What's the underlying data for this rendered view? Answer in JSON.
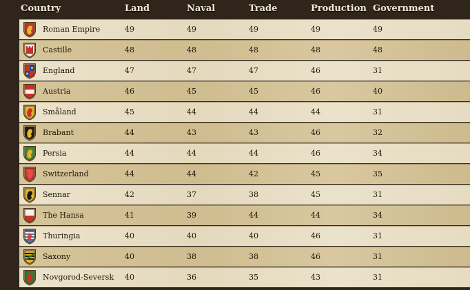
{
  "table": {
    "headers": [
      "Country",
      "Land",
      "Naval",
      "Trade",
      "Production",
      "Government"
    ],
    "rows": [
      {
        "country": "Roman Empire",
        "land": "49",
        "naval": "49",
        "trade": "49",
        "production": "49",
        "government": "49",
        "icon": "eagle-shield-icon",
        "shield_color": "#c8322a",
        "emblem_color": "#e8b830"
      },
      {
        "country": "Castille",
        "land": "48",
        "naval": "48",
        "trade": "48",
        "production": "48",
        "government": "48",
        "icon": "castle-shield-icon",
        "shield_color": "#f2f0ea",
        "emblem_color": "#c8322a"
      },
      {
        "country": "England",
        "land": "47",
        "naval": "47",
        "trade": "47",
        "production": "46",
        "government": "31",
        "icon": "quartered-shield-icon",
        "shield_color": "#2a3f9a",
        "emblem_color": "#c8322a"
      },
      {
        "country": "Austria",
        "land": "46",
        "naval": "45",
        "trade": "45",
        "production": "46",
        "government": "40",
        "icon": "fess-shield-icon",
        "shield_color": "#d42a2a",
        "emblem_color": "#f4f1ea"
      },
      {
        "country": "Småland",
        "land": "45",
        "naval": "44",
        "trade": "44",
        "production": "44",
        "government": "31",
        "icon": "lion-shield-icon",
        "shield_color": "#e3b32a",
        "emblem_color": "#c8322a"
      },
      {
        "country": "Brabant",
        "land": "44",
        "naval": "43",
        "trade": "43",
        "production": "46",
        "government": "32",
        "icon": "lion-shield-icon",
        "shield_color": "#1c1a16",
        "emblem_color": "#e3b32a"
      },
      {
        "country": "Persia",
        "land": "44",
        "naval": "44",
        "trade": "44",
        "production": "46",
        "government": "34",
        "icon": "lion-shield-icon",
        "shield_color": "#3d8a36",
        "emblem_color": "#e3b32a"
      },
      {
        "country": "Switzerland",
        "land": "44",
        "naval": "44",
        "trade": "42",
        "production": "45",
        "government": "35",
        "icon": "plain-shield-icon",
        "shield_color": "#d63030",
        "emblem_color": "#e85a4a"
      },
      {
        "country": "Sennar",
        "land": "42",
        "naval": "37",
        "trade": "38",
        "production": "45",
        "government": "31",
        "icon": "lion-shield-icon",
        "shield_color": "#e3b32a",
        "emblem_color": "#1c1a16"
      },
      {
        "country": "The Hansa",
        "land": "41",
        "naval": "39",
        "trade": "44",
        "production": "44",
        "government": "34",
        "icon": "per-fess-shield-icon",
        "shield_color": "#f4f1ea",
        "emblem_color": "#c8322a"
      },
      {
        "country": "Thuringia",
        "land": "40",
        "naval": "40",
        "trade": "40",
        "production": "46",
        "government": "31",
        "icon": "striped-lion-shield-icon",
        "shield_color": "#4a78c8",
        "emblem_color": "#d63030"
      },
      {
        "country": "Saxony",
        "land": "40",
        "naval": "38",
        "trade": "38",
        "production": "46",
        "government": "31",
        "icon": "barry-shield-icon",
        "shield_color": "#e3b32a",
        "emblem_color": "#2f7a2f"
      },
      {
        "country": "Novgorod-Seversk",
        "land": "40",
        "naval": "36",
        "trade": "35",
        "production": "43",
        "government": "31",
        "icon": "beast-shield-icon",
        "shield_color": "#2f7a2f",
        "emblem_color": "#c8322a"
      }
    ]
  }
}
